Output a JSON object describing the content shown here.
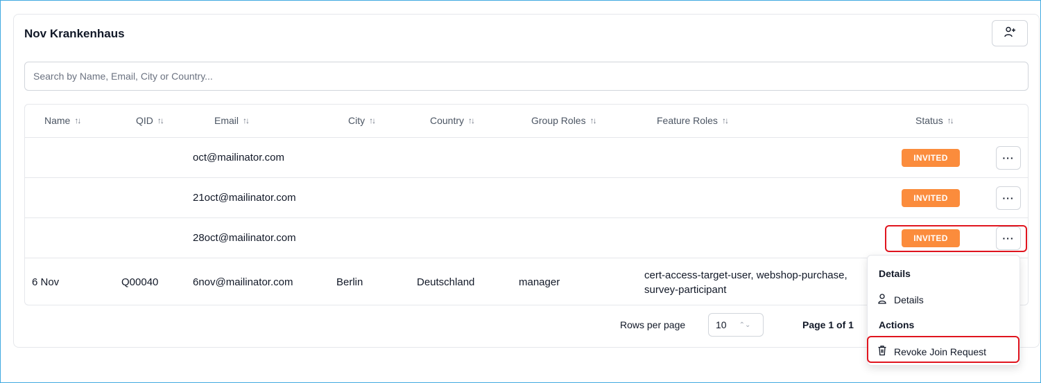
{
  "group": {
    "title": "Nov Krankenhaus"
  },
  "icons": {
    "add_user": "user-plus-icon",
    "sort": "sort-arrows-icon",
    "more": "more-horizontal-icon",
    "person": "person-icon",
    "trash": "trash-icon",
    "caret": "chevron-up-down-icon"
  },
  "search": {
    "placeholder": "Search by Name, Email, City or Country..."
  },
  "table": {
    "columns": [
      "Name",
      "QID",
      "Email",
      "City",
      "Country",
      "Group Roles",
      "Feature Roles",
      "Status"
    ],
    "rows": [
      {
        "name": "",
        "qid": "",
        "email": "oct@mailinator.com",
        "city": "",
        "country": "",
        "group_roles": "",
        "feature_roles": "",
        "status": "INVITED"
      },
      {
        "name": "",
        "qid": "",
        "email": "21oct@mailinator.com",
        "city": "",
        "country": "",
        "group_roles": "",
        "feature_roles": "",
        "status": "INVITED"
      },
      {
        "name": "",
        "qid": "",
        "email": "28oct@mailinator.com",
        "city": "",
        "country": "",
        "group_roles": "",
        "feature_roles": "",
        "status": "INVITED"
      },
      {
        "name": "6 Nov",
        "qid": "Q00040",
        "email": "6nov@mailinator.com",
        "city": "Berlin",
        "country": "Deutschland",
        "group_roles": "manager",
        "feature_roles": "cert-access-target-user, webshop-purchase, survey-participant",
        "status": ""
      }
    ],
    "more_label": "···"
  },
  "pagination": {
    "rows_per_page_label": "Rows per page",
    "rows_per_page_value": "10",
    "page_label": "Page 1 of 1"
  },
  "context_menu": {
    "section_details": "Details",
    "details_item": "Details",
    "section_actions": "Actions",
    "revoke_item": "Revoke Join Request"
  },
  "colors": {
    "status_invited": "#fb8c3c",
    "highlight": "#e0141e",
    "frame": "#3fa9e0"
  }
}
